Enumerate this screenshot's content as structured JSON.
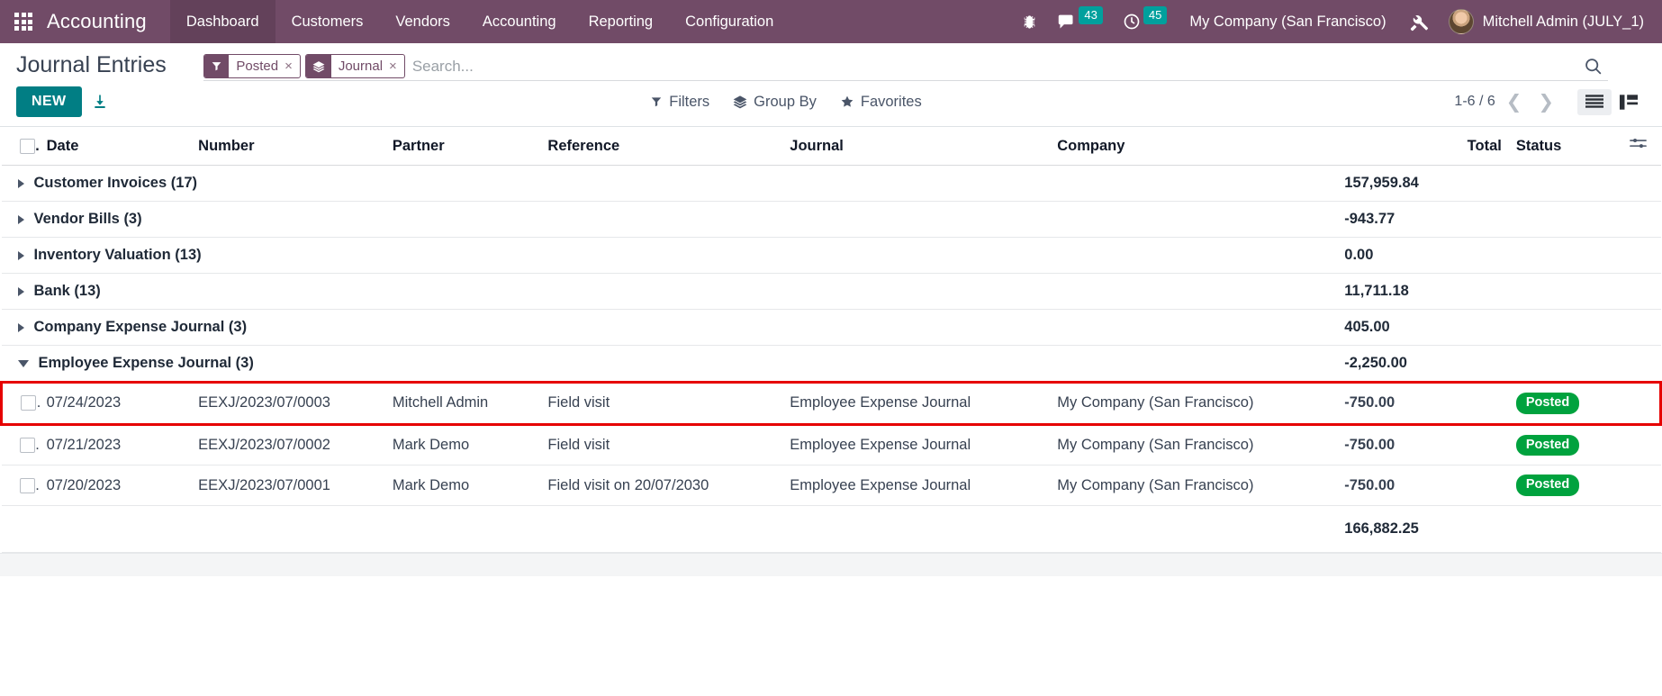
{
  "navbar": {
    "apps_icon": "grid-apps-icon",
    "brand": "Accounting",
    "menus": [
      {
        "label": "Dashboard",
        "active": true
      },
      {
        "label": "Customers",
        "active": false
      },
      {
        "label": "Vendors",
        "active": false
      },
      {
        "label": "Accounting",
        "active": false
      },
      {
        "label": "Reporting",
        "active": false
      },
      {
        "label": "Configuration",
        "active": false
      }
    ],
    "debug_icon": "bug-icon",
    "messages_icon": "chat-bubble-icon",
    "messages_count": "43",
    "activities_icon": "clock-icon",
    "activities_count": "45",
    "company": "My Company (San Francisco)",
    "tools_icon": "tools-icon",
    "user_name": "Mitchell Admin (JULY_1)",
    "avatar_icon": "user-avatar"
  },
  "control_panel": {
    "page_title": "Journal Entries",
    "new_label": "NEW",
    "export_icon": "download-icon",
    "filters_label": "Filters",
    "filters_icon": "filter-icon",
    "groupby_label": "Group By",
    "groupby_icon": "layers-icon",
    "favorites_label": "Favorites",
    "favorites_icon": "star-icon",
    "pager": "1-6 / 6",
    "pager_prev_icon": "chevron-left-icon",
    "pager_next_icon": "chevron-right-icon",
    "view_list_icon": "list-view-icon",
    "view_kanban_icon": "kanban-view-icon"
  },
  "search": {
    "placeholder": "Search...",
    "search_icon": "search-icon",
    "facets": [
      {
        "icon": "filter-icon",
        "label": "Posted",
        "remove": "×"
      },
      {
        "icon": "layers-icon",
        "label": "Journal",
        "remove": "×"
      }
    ]
  },
  "table": {
    "columns": [
      {
        "key": "check",
        "label": ""
      },
      {
        "key": "date",
        "label": "Date"
      },
      {
        "key": "number",
        "label": "Number"
      },
      {
        "key": "partner",
        "label": "Partner"
      },
      {
        "key": "reference",
        "label": "Reference"
      },
      {
        "key": "journal",
        "label": "Journal"
      },
      {
        "key": "company",
        "label": "Company"
      },
      {
        "key": "total",
        "label": "Total"
      },
      {
        "key": "status",
        "label": "Status"
      },
      {
        "key": "options",
        "label": ""
      }
    ],
    "optional_columns_icon": "settings-sliders-icon",
    "groups": [
      {
        "label": "Customer Invoices (17)",
        "total": "157,959.84",
        "expanded": false
      },
      {
        "label": "Vendor Bills (3)",
        "total": "-943.77",
        "expanded": false
      },
      {
        "label": "Inventory Valuation (13)",
        "total": "0.00",
        "expanded": false
      },
      {
        "label": "Bank (13)",
        "total": "11,711.18",
        "expanded": false
      },
      {
        "label": "Company Expense Journal (3)",
        "total": "405.00",
        "expanded": false
      },
      {
        "label": "Employee Expense Journal (3)",
        "total": "-2,250.00",
        "expanded": true
      }
    ],
    "rows": [
      {
        "date": "07/24/2023",
        "number": "EEXJ/2023/07/0003",
        "partner": "Mitchell Admin",
        "reference": "Field visit",
        "journal": "Employee Expense Journal",
        "company": "My Company (San Francisco)",
        "total": "-750.00",
        "status": "Posted",
        "highlighted": true
      },
      {
        "date": "07/21/2023",
        "number": "EEXJ/2023/07/0002",
        "partner": "Mark Demo",
        "reference": "Field visit",
        "journal": "Employee Expense Journal",
        "company": "My Company (San Francisco)",
        "total": "-750.00",
        "status": "Posted",
        "highlighted": false
      },
      {
        "date": "07/20/2023",
        "number": "EEXJ/2023/07/0001",
        "partner": "Mark Demo",
        "reference": "Field visit on 20/07/2030",
        "journal": "Employee Expense Journal",
        "company": "My Company (San Francisco)",
        "total": "-750.00",
        "status": "Posted",
        "highlighted": false
      }
    ],
    "grand_total": "166,882.25"
  },
  "colors": {
    "brand_purple": "#714B67",
    "teal_accent": "#017E84",
    "counter_badge": "#00A09D",
    "status_green": "#00A23E",
    "highlight_red": "#E60000"
  }
}
